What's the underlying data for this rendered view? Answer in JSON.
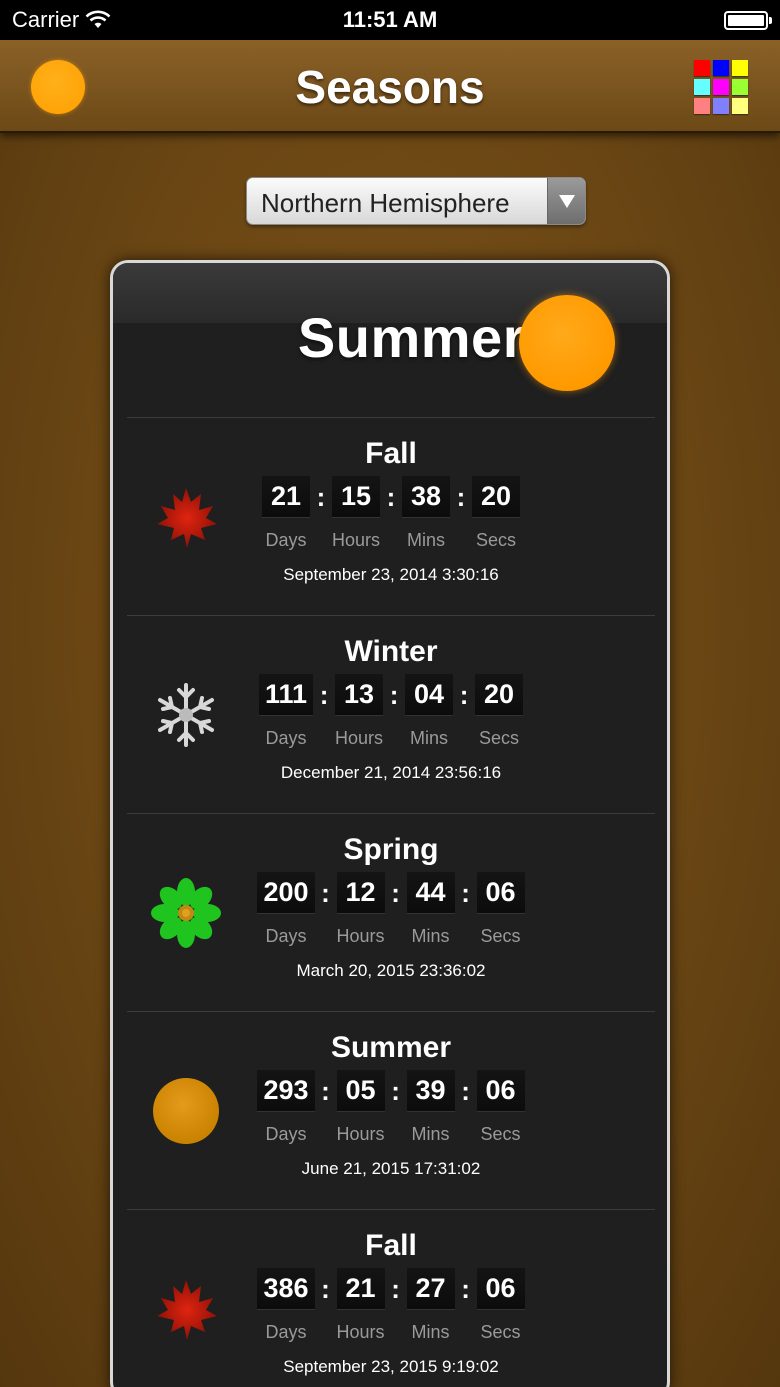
{
  "status_bar": {
    "carrier": "Carrier",
    "time": "11:51 AM"
  },
  "nav": {
    "title": "Seasons",
    "left_icon": "sun-icon",
    "right_icon": "color-palette-icon",
    "palette_colors": [
      "#ff0000",
      "#0000ff",
      "#ffff00",
      "#66ffff",
      "#ff00ff",
      "#99ff33",
      "#ff8080",
      "#8080ff",
      "#ffff80"
    ]
  },
  "hemisphere": {
    "selected": "Northern Hemisphere"
  },
  "current": {
    "season": "Summer",
    "icon": "sun-icon"
  },
  "seasons": [
    {
      "name": "Fall",
      "icon": "maple-leaf-icon",
      "days": "21",
      "hours": "15",
      "mins": "38",
      "secs": "20",
      "date": "September 23, 2014  3:30:16"
    },
    {
      "name": "Winter",
      "icon": "snowflake-icon",
      "days": "111",
      "hours": "13",
      "mins": "04",
      "secs": "20",
      "date": "December 21, 2014  23:56:16"
    },
    {
      "name": "Spring",
      "icon": "flower-icon",
      "days": "200",
      "hours": "12",
      "mins": "44",
      "secs": "06",
      "date": "March 20, 2015  23:36:02"
    },
    {
      "name": "Summer",
      "icon": "sun-icon",
      "days": "293",
      "hours": "05",
      "mins": "39",
      "secs": "06",
      "date": "June 21, 2015  17:31:02"
    },
    {
      "name": "Fall",
      "icon": "maple-leaf-icon",
      "days": "386",
      "hours": "21",
      "mins": "27",
      "secs": "06",
      "date": "September 23, 2015  9:19:02"
    }
  ],
  "labels": {
    "days": "Days",
    "hours": "Hours",
    "mins": "Mins",
    "secs": "Secs",
    "sep": ":"
  }
}
